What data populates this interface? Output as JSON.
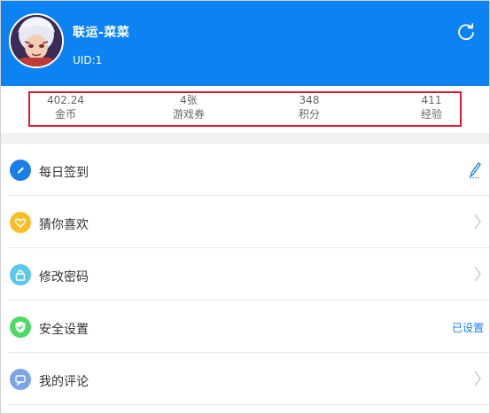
{
  "profile": {
    "name": "联运-菜菜",
    "uid": "UID:1"
  },
  "stats": [
    {
      "value": "402.24",
      "label": "金币"
    },
    {
      "value": "4张",
      "label": "游戏券"
    },
    {
      "value": "348",
      "label": "积分"
    },
    {
      "value": "411",
      "label": "经验"
    }
  ],
  "menu": [
    {
      "label": "每日签到",
      "icon": "pencil-icon",
      "icon_color": "#1a7ee8",
      "right": "edit-icon"
    },
    {
      "label": "猜你喜欢",
      "icon": "heart-icon",
      "icon_color": "#fbbd26",
      "right": "chevron-right-icon"
    },
    {
      "label": "修改密码",
      "icon": "lock-icon",
      "icon_color": "#5ac8e8",
      "right": "chevron-right-icon"
    },
    {
      "label": "安全设置",
      "icon": "shield-icon",
      "icon_color": "#4cd964",
      "right_text": "已设置"
    },
    {
      "label": "我的评论",
      "icon": "comment-icon",
      "icon_color": "#7aa6e8",
      "right": "chevron-right-icon"
    }
  ],
  "colors": {
    "header": "#0d83f3",
    "highlight_border": "#e0182d",
    "status_blue": "#1a7ee8"
  }
}
